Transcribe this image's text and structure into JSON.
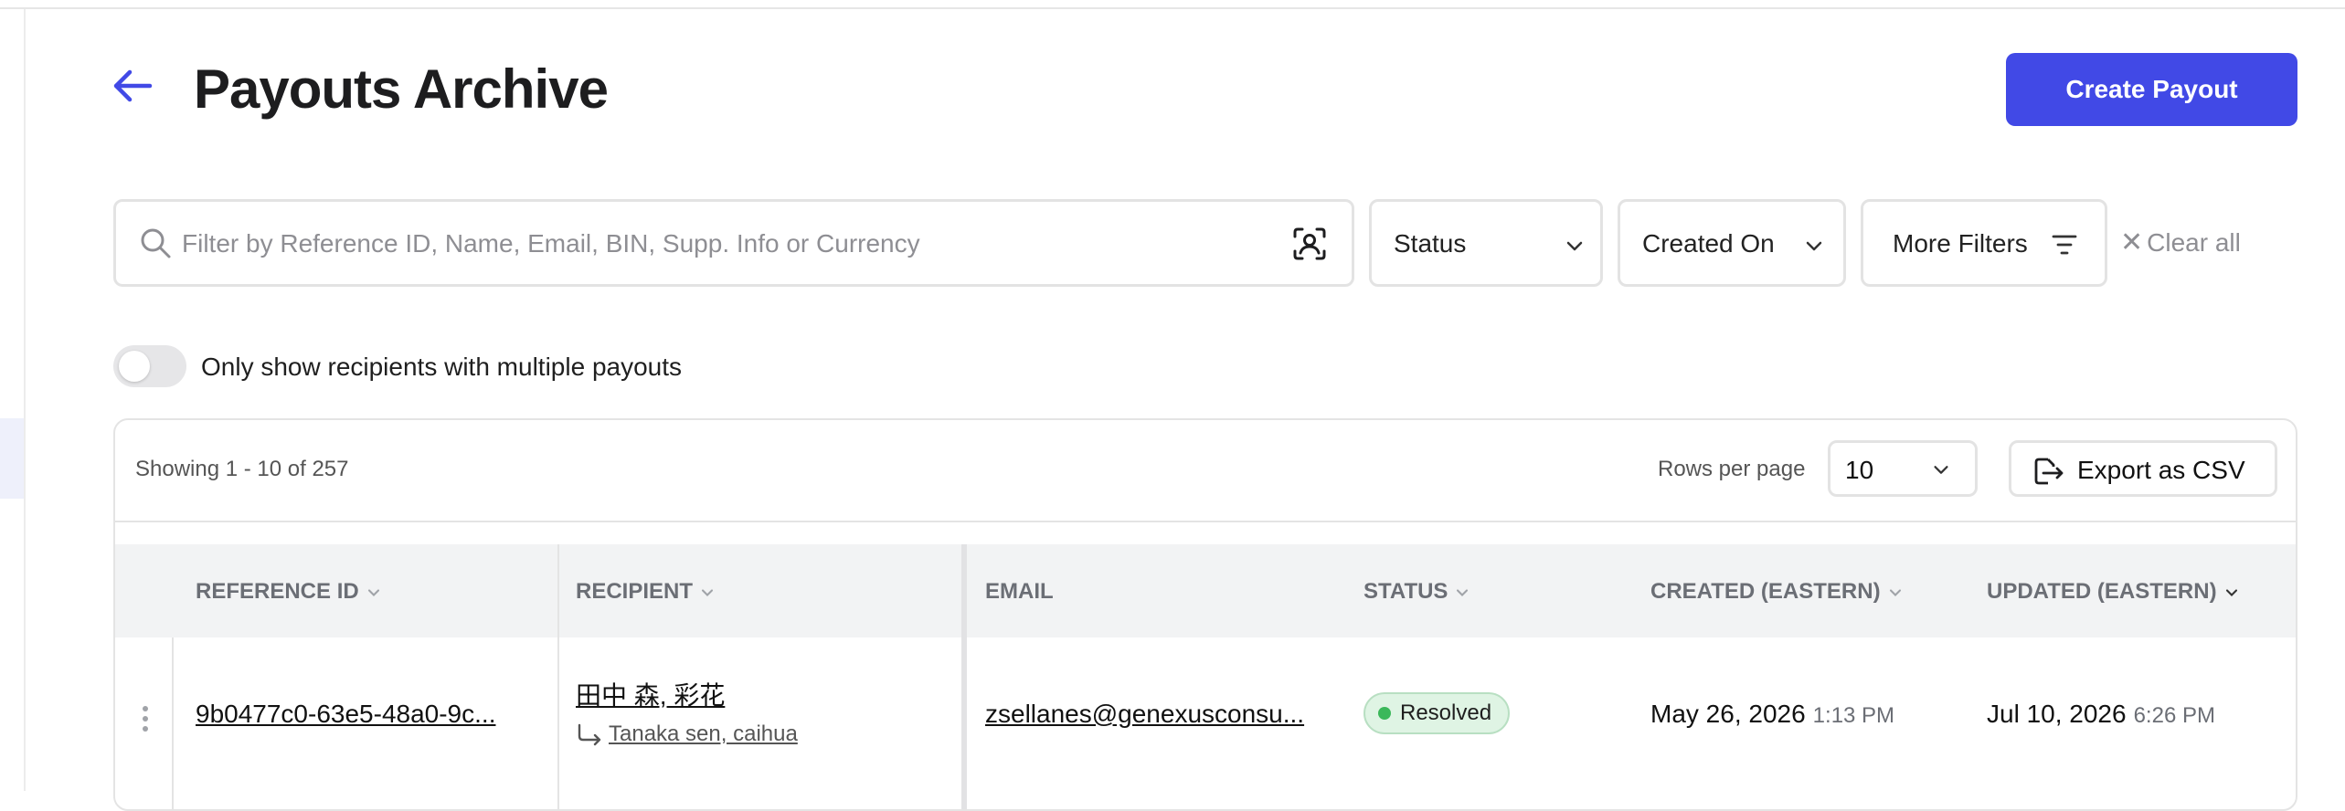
{
  "page": {
    "title": "Payouts Archive",
    "create_label": "Create Payout"
  },
  "filters": {
    "search_placeholder": "Filter by Reference ID, Name, Email, BIN, Supp. Info or Currency",
    "status_label": "Status",
    "created_label": "Created On",
    "more_label": "More Filters",
    "clear_label": "Clear all"
  },
  "toggle": {
    "label": "Only show recipients with multiple payouts",
    "on": false
  },
  "table": {
    "showing": "Showing 1 - 10 of 257",
    "rows_per_page_label": "Rows per page",
    "rows_per_page_value": "10",
    "export_label": "Export as CSV",
    "columns": [
      "REFERENCE ID",
      "RECIPIENT",
      "EMAIL",
      "STATUS",
      "CREATED (EASTERN)",
      "UPDATED (EASTERN)"
    ],
    "rows": [
      {
        "reference_id": "9b0477c0-63e5-48a0-9c...",
        "recipient_name": "田中 森, 彩花",
        "recipient_sub": "Tanaka sen, caihua",
        "email": "zsellanes@genexusconsu...",
        "status": "Resolved",
        "created_date": "May 26, 2026",
        "created_time": "1:13 PM",
        "updated_date": "Jul 10, 2026",
        "updated_time": "6:26 PM"
      }
    ]
  },
  "colors": {
    "accent": "#4149e6",
    "status_resolved_bg": "#dff4e4",
    "status_resolved_dot": "#3bb85a"
  },
  "icons": [
    "back-arrow-icon",
    "search-icon",
    "face-scan-icon",
    "chevron-down-icon",
    "filter-lines-icon",
    "close-icon",
    "export-icon",
    "drag-handle-icon"
  ]
}
